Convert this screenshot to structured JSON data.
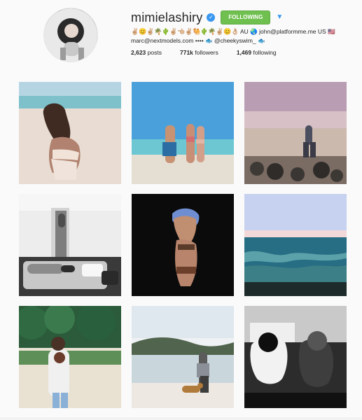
{
  "profile": {
    "username": "mimielashiry",
    "follow_label": "FOLLOWING",
    "bio_line1_emojis": "✌🏼😊✌🏼🌴🌵✌🏼👈🏼✌🏼🐫🌵🌴✌🏼😊👌🏼",
    "bio_line1_text": "AU 🌏 john@platformme.me US 🇺🇸",
    "bio_line2": "marc@nextmodels.com •••• 🐟 @cheekyswim_ 🐟",
    "stats": {
      "posts_value": "2,623",
      "posts_label": "posts",
      "followers_value": "771k",
      "followers_label": "followers",
      "following_value": "1,469",
      "following_label": "following"
    }
  },
  "colors": {
    "follow_green": "#70c050",
    "verified_blue": "#3897f0",
    "background": "#fafafa"
  },
  "icons": {
    "verified": "verified-badge-icon",
    "dropdown": "chevron-down-icon"
  },
  "posts": [
    {
      "id": "beach-portrait"
    },
    {
      "id": "beach-group"
    },
    {
      "id": "rocky-beach-sunset"
    },
    {
      "id": "bw-bedroom"
    },
    {
      "id": "night-swimwear"
    },
    {
      "id": "ocean-waves"
    },
    {
      "id": "dog-trail"
    },
    {
      "id": "beach-dog-walk"
    },
    {
      "id": "bw-car"
    }
  ]
}
